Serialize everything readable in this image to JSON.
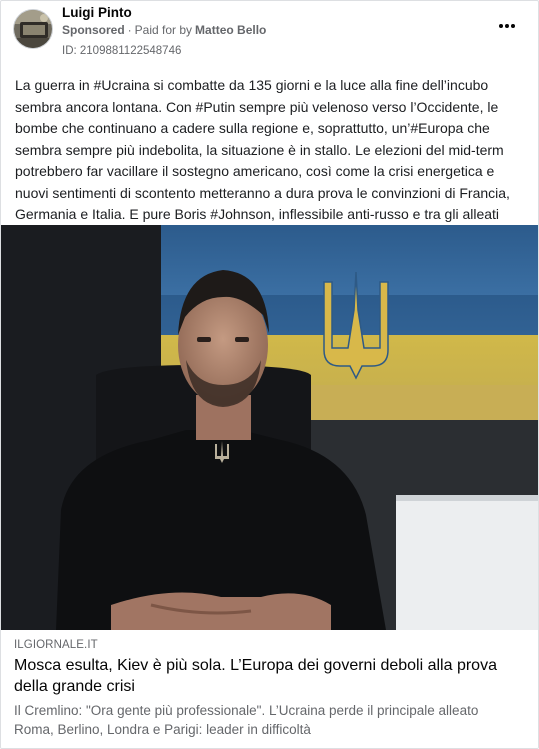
{
  "post": {
    "page_name": "Luigi Pinto",
    "sponsored_label": "Sponsored",
    "paid_prefix": "Paid for by",
    "payer": "Matteo Bello",
    "ad_id": "ID: 2109881122548746",
    "more_icon": "more-horizontal-icon",
    "body_text": "La guerra in #Ucraina si combatte da 135 giorni e la luce alla fine dell’incubo sembra ancora lontana. Con #Putin sempre più velenoso verso l’Occidente, le bombe che continuano a cadere sulla regione e, soprattutto, un’#Europa che sembra sempre più indebolita, la situazione è in stallo. Le elezioni del mid-term potrebbero far vacillare il sostegno americano, così come la crisi energetica e nuovi sentimenti di scontento metteranno a dura prova le convinzioni di Francia, Germania e Italia. E pure Boris #Johnson, inflessibile anti-russo e tra gli alleati più…"
  },
  "link": {
    "domain": "ILGIORNALE.IT",
    "headline": "Mosca esulta, Kiev è più sola. L’Europa dei governi deboli alla prova della grande crisi",
    "description_line1": "Il Cremlino: \"Ora gente più professionale\". L’Ucraina perde il principale alleato",
    "description_line2": "Roma, Berlino, Londra e Parigi: leader in difficoltà"
  },
  "colors": {
    "text": "#1c1e21",
    "secondary": "#65676b",
    "flag_blue": "#2f5e8f",
    "flag_yellow": "#e2c649"
  }
}
